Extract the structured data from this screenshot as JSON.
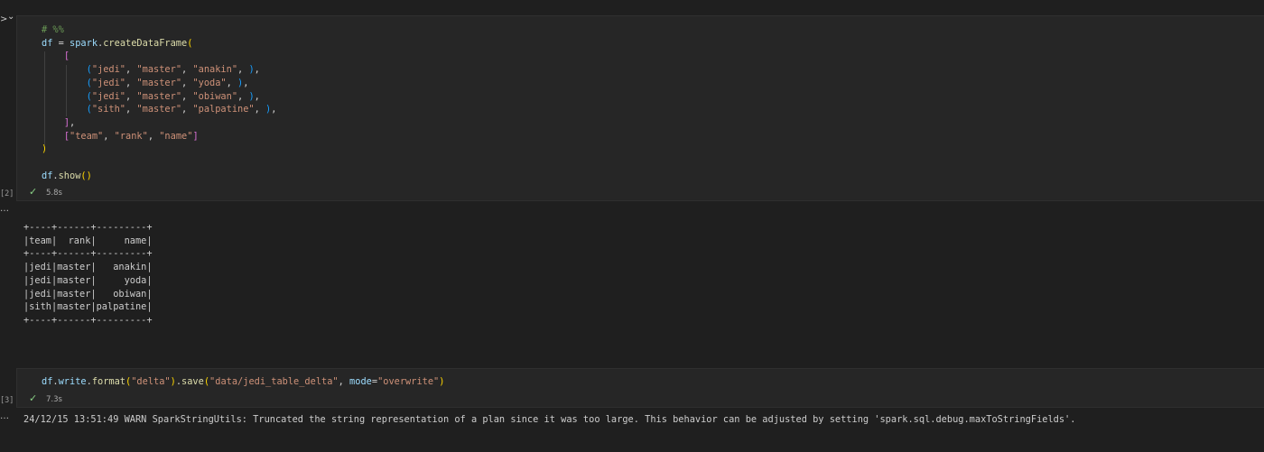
{
  "cell1": {
    "execution_count": "[2]",
    "timing": "5.8s",
    "lines": {
      "comment": "# %%",
      "df_var": "df",
      "assign": " = ",
      "spark": "spark",
      "create_fn": "createDataFrame",
      "row1": [
        "\"jedi\"",
        "\"master\"",
        "\"anakin\""
      ],
      "row2": [
        "\"jedi\"",
        "\"master\"",
        "\"yoda\""
      ],
      "row3": [
        "\"jedi\"",
        "\"master\"",
        "\"obiwan\""
      ],
      "row4": [
        "\"sith\"",
        "\"master\"",
        "\"palpatine\""
      ],
      "columns": [
        "\"team\"",
        "\"rank\"",
        "\"name\""
      ],
      "show_call_obj": "df",
      "show_fn": "show"
    }
  },
  "output1": {
    "table_text": "+----+------+---------+\n|team|  rank|     name|\n+----+------+---------+\n|jedi|master|   anakin|\n|jedi|master|     yoda|\n|jedi|master|   obiwan|\n|sith|master|palpatine|\n+----+------+---------+"
  },
  "cell2": {
    "execution_count": "[3]",
    "timing": "7.3s",
    "df_var": "df",
    "write_attr": "write",
    "format_fn": "format",
    "format_arg": "\"delta\"",
    "save_fn": "save",
    "save_path": "\"data/jedi_table_delta\"",
    "mode_kw": "mode",
    "mode_val": "\"overwrite\""
  },
  "output2": {
    "warn_text": "24/12/15 13:51:49 WARN SparkStringUtils: Truncated the string representation of a plan since it was too large. This behavior can be adjusted by setting 'spark.sql.debug.maxToStringFields'."
  },
  "ui": {
    "run_chevron": ">",
    "expand_chevron": "⌄",
    "output_menu": "…",
    "check_mark": "✓"
  }
}
